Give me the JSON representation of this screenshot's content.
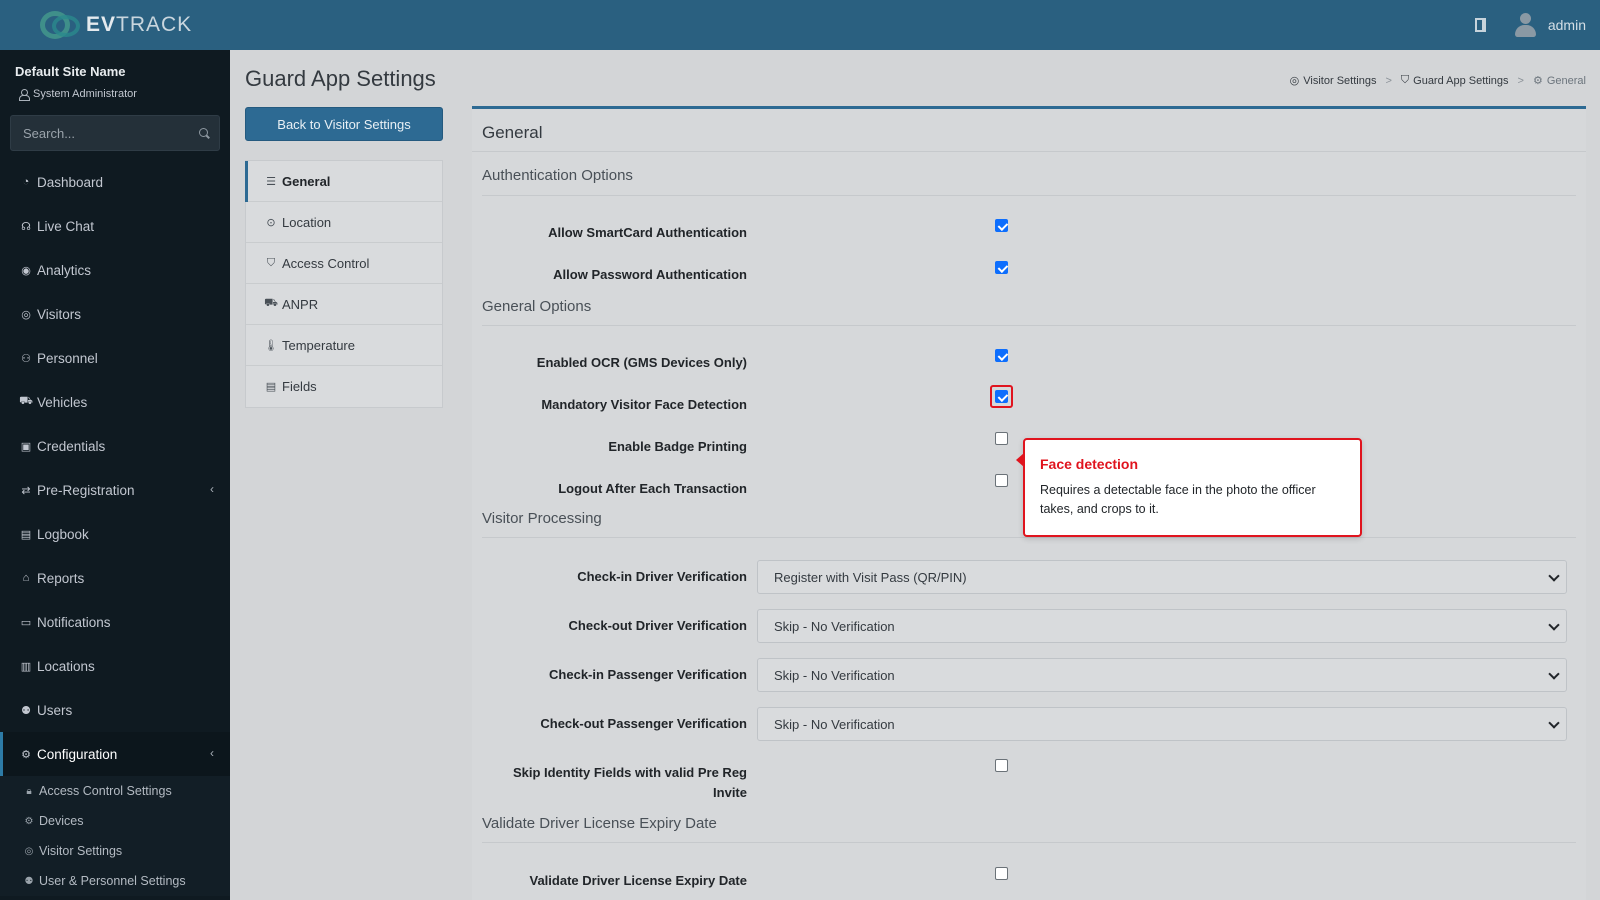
{
  "brand": {
    "prefix": "EV",
    "suffix": "TRACK"
  },
  "header": {
    "user_name": "admin"
  },
  "sidebar": {
    "site_name": "Default Site Name",
    "role": "System Administrator",
    "search_placeholder": "Search...",
    "items": [
      {
        "label": "Dashboard",
        "icon": "dashboard-icon"
      },
      {
        "label": "Live Chat",
        "icon": "headset-icon"
      },
      {
        "label": "Analytics",
        "icon": "analytics-icon"
      },
      {
        "label": "Visitors",
        "icon": "eye-icon"
      },
      {
        "label": "Personnel",
        "icon": "personnel-icon"
      },
      {
        "label": "Vehicles",
        "icon": "car-icon"
      },
      {
        "label": "Credentials",
        "icon": "credentials-icon"
      },
      {
        "label": "Pre-Registration",
        "icon": "exchange-icon"
      },
      {
        "label": "Logbook",
        "icon": "book-icon"
      },
      {
        "label": "Reports",
        "icon": "reports-icon"
      },
      {
        "label": "Notifications",
        "icon": "notifications-icon"
      },
      {
        "label": "Locations",
        "icon": "map-icon"
      },
      {
        "label": "Users",
        "icon": "users-icon"
      },
      {
        "label": "Configuration",
        "icon": "cog-icon"
      }
    ],
    "sub_items": [
      {
        "label": "Access Control Settings",
        "icon": "lock-icon"
      },
      {
        "label": "Devices",
        "icon": "gear-icon"
      },
      {
        "label": "Visitor Settings",
        "icon": "eye-icon"
      },
      {
        "label": "User & Personnel Settings",
        "icon": "users-icon"
      }
    ]
  },
  "page": {
    "title": "Guard App Settings",
    "back_button": "Back to Visitor Settings"
  },
  "breadcrumb": [
    "Visitor Settings",
    "Guard App Settings",
    "General"
  ],
  "tabs": [
    {
      "label": "General",
      "icon": "sliders-icon"
    },
    {
      "label": "Location",
      "icon": "map-pin-icon"
    },
    {
      "label": "Access Control",
      "icon": "shield-icon"
    },
    {
      "label": "ANPR",
      "icon": "car-icon"
    },
    {
      "label": "Temperature",
      "icon": "thermometer-icon"
    },
    {
      "label": "Fields",
      "icon": "list-icon"
    }
  ],
  "card": {
    "title": "General",
    "sections": {
      "auth": "Authentication Options",
      "general": "General Options",
      "visitor": "Visitor Processing",
      "license": "Validate Driver License Expiry Date"
    },
    "fields": {
      "smartcard": {
        "label": "Allow SmartCard Authentication",
        "checked": true
      },
      "password": {
        "label": "Allow Password Authentication",
        "checked": true
      },
      "ocr": {
        "label": "Enabled OCR (GMS Devices Only)",
        "checked": true
      },
      "face": {
        "label": "Mandatory Visitor Face Detection",
        "checked": true
      },
      "badge": {
        "label": "Enable Badge Printing",
        "checked": false
      },
      "logout": {
        "label": "Logout After Each Transaction",
        "checked": false
      },
      "checkin_driver": {
        "label": "Check-in Driver Verification",
        "value": "Register with Visit Pass (QR/PIN)"
      },
      "checkout_driver": {
        "label": "Check-out Driver Verification",
        "value": "Skip - No Verification"
      },
      "checkin_passenger": {
        "label": "Check-in Passenger Verification",
        "value": "Skip - No Verification"
      },
      "checkout_passenger": {
        "label": "Check-out Passenger Verification",
        "value": "Skip - No Verification"
      },
      "skip_identity": {
        "label": "Skip Identity Fields with valid Pre Reg Invite",
        "checked": false
      },
      "license_expiry": {
        "label": "Validate Driver License Expiry Date",
        "checked": false
      }
    }
  },
  "tooltip": {
    "title": "Face detection",
    "body": "Requires a detectable face in the photo the officer takes, and crops to it."
  },
  "colors": {
    "accent": "#2d6a93",
    "highlight": "#e0141e",
    "checkbox": "#0d6efd"
  }
}
